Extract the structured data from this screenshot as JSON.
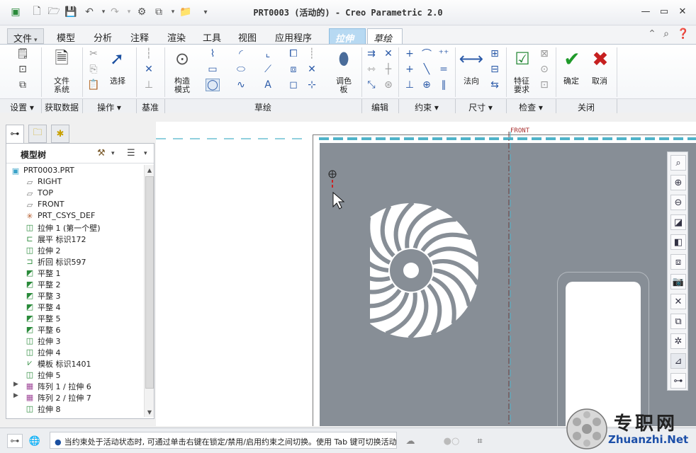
{
  "window": {
    "title": "PRT0003 (活动的) - Creo Parametric 2.0"
  },
  "tabs": [
    {
      "label": "文件",
      "caret": "▾"
    },
    {
      "label": "模型"
    },
    {
      "label": "分析"
    },
    {
      "label": "注释"
    },
    {
      "label": "渲染"
    },
    {
      "label": "工具"
    },
    {
      "label": "视图"
    },
    {
      "label": "应用程序"
    },
    {
      "label": "拉伸"
    },
    {
      "label": "草绘"
    }
  ],
  "ribbon": {
    "file_system": "文件\n系统",
    "select": "选择",
    "construct_mode": "构造\n模式",
    "palette": "调色\n板",
    "normal": "法向",
    "feature_req": "特征\n要求",
    "ok": "确定",
    "cancel": "取消",
    "groups": [
      "设置 ▾",
      "获取数据",
      "操作 ▾",
      "基准",
      "草绘",
      "编辑",
      "约束 ▾",
      "尺寸 ▾",
      "检查 ▾",
      "关闭"
    ]
  },
  "model_tree": {
    "title": "模型树",
    "items": [
      {
        "label": "PRT0003.PRT",
        "icon": "part-icon"
      },
      {
        "label": "RIGHT",
        "icon": "datum-plane-icon"
      },
      {
        "label": "TOP",
        "icon": "datum-plane-icon"
      },
      {
        "label": "FRONT",
        "icon": "datum-plane-icon"
      },
      {
        "label": "PRT_CSYS_DEF",
        "icon": "csys-icon"
      },
      {
        "label": "拉伸 1 (第一个壁)",
        "icon": "extrude-icon"
      },
      {
        "label": "展平 标识172",
        "icon": "unbend-icon"
      },
      {
        "label": "拉伸 2",
        "icon": "extrude-icon"
      },
      {
        "label": "折回 标识597",
        "icon": "bendback-icon"
      },
      {
        "label": "平整 1",
        "icon": "flat-wall-icon"
      },
      {
        "label": "平整 2",
        "icon": "flat-wall-icon"
      },
      {
        "label": "平整 3",
        "icon": "flat-wall-icon"
      },
      {
        "label": "平整 4",
        "icon": "flat-wall-icon"
      },
      {
        "label": "平整 5",
        "icon": "flat-wall-icon"
      },
      {
        "label": "平整 6",
        "icon": "flat-wall-icon"
      },
      {
        "label": "拉伸 3",
        "icon": "extrude-icon"
      },
      {
        "label": "拉伸 4",
        "icon": "extrude-icon"
      },
      {
        "label": "模板 标识1401",
        "icon": "form-icon"
      },
      {
        "label": "拉伸 5",
        "icon": "extrude-icon"
      },
      {
        "label": "阵列 1 / 拉伸 6",
        "icon": "pattern-icon",
        "expandable": true
      },
      {
        "label": "阵列 2 / 拉伸 7",
        "icon": "pattern-icon",
        "expandable": true
      },
      {
        "label": "拉伸 8",
        "icon": "extrude-icon"
      }
    ]
  },
  "graphics": {
    "front_label": "FRONT"
  },
  "status": {
    "message": "当约束处于活动状态时, 可通过单击右键在锁定/禁用/启用约束之间切换。使用 Tab 键可切换活动"
  },
  "watermark": {
    "cn": "专职网",
    "en": "Zhuanzhi.Net"
  },
  "colors": {
    "part_gray": "#878e96",
    "sketch_tab": "#b7d9f2",
    "accent_blue": "#2b5aa8"
  }
}
